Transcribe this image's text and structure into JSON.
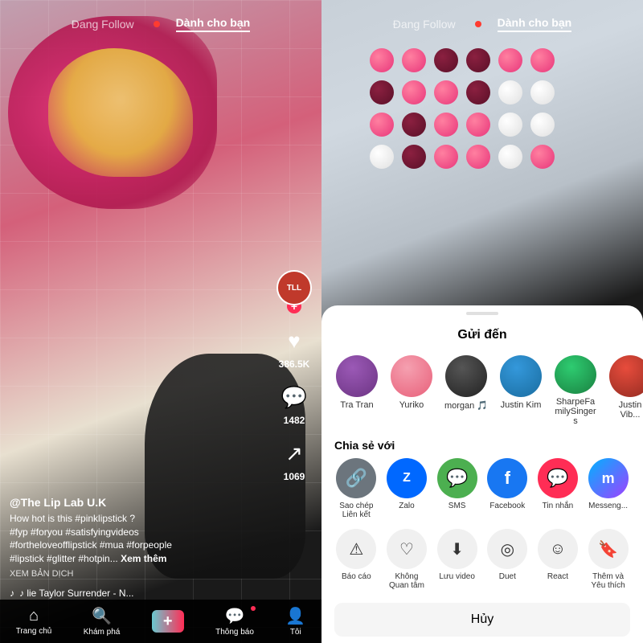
{
  "left": {
    "nav": {
      "tab1": "Đang Follow",
      "live_dot": true,
      "tab2": "Dành cho bạn"
    },
    "video": {
      "username": "@The Lip Lab U.K",
      "description": "How hot is this #pinklipstick ?\n#fyp #foryou #satisfyingvideos\n#fortheloveofflipstick #mua #forpeople\n#lipstick #glitter #hotpin...  ",
      "see_more": "Xem thêm",
      "translate": "XEM BẢN DỊCH",
      "music": "♪ lie Taylor  Surrender - N..."
    },
    "actions": {
      "likes": "386.5K",
      "comments": "1482",
      "shares": "1069"
    },
    "bottom_nav": [
      {
        "label": "Trang chủ",
        "icon": "⌂",
        "active": true
      },
      {
        "label": "Khám phá",
        "icon": "🔍",
        "active": false
      },
      {
        "label": "",
        "icon": "+",
        "active": false
      },
      {
        "label": "Thông báo",
        "icon": "💬",
        "active": false
      },
      {
        "label": "Tôi",
        "icon": "👤",
        "active": false
      }
    ]
  },
  "right": {
    "nav": {
      "tab1": "Đang Follow",
      "live_dot": true,
      "tab2": "Dành cho bạn"
    },
    "share_sheet": {
      "title": "Gửi đến",
      "friends": [
        {
          "name": "Tra Tran",
          "color": "fa1"
        },
        {
          "name": "Yuriko",
          "color": "fa2"
        },
        {
          "name": "morgan 🎵",
          "color": "fa3"
        },
        {
          "name": "Justin Kim",
          "color": "fa4"
        },
        {
          "name": "SharpeFamilySingers",
          "color": "fa5"
        },
        {
          "name": "Justin Vib...",
          "color": "fa6"
        }
      ],
      "share_section": "Chia sẻ với",
      "share_options": [
        {
          "label": "Sao chép\nLiên kết",
          "icon": "🔗",
          "class": "si-link"
        },
        {
          "label": "Zalo",
          "icon": "Z",
          "class": "si-zalo"
        },
        {
          "label": "SMS",
          "icon": "💬",
          "class": "si-sms"
        },
        {
          "label": "Facebook",
          "icon": "f",
          "class": "si-fb"
        },
        {
          "label": "Tin nhắn",
          "icon": "💬",
          "class": "si-tinnhan"
        },
        {
          "label": "Messeng...",
          "icon": "m",
          "class": "si-messenger"
        }
      ],
      "actions": [
        {
          "label": "Báo cáo",
          "icon": "⚠"
        },
        {
          "label": "Không\nQuan tâm",
          "icon": "♡"
        },
        {
          "label": "Lưu video",
          "icon": "⬇"
        },
        {
          "label": "Duet",
          "icon": "◎"
        },
        {
          "label": "React",
          "icon": "☺"
        },
        {
          "label": "Thêm và\nYêu thích",
          "icon": "🔖"
        }
      ],
      "cancel": "Hủy"
    }
  }
}
